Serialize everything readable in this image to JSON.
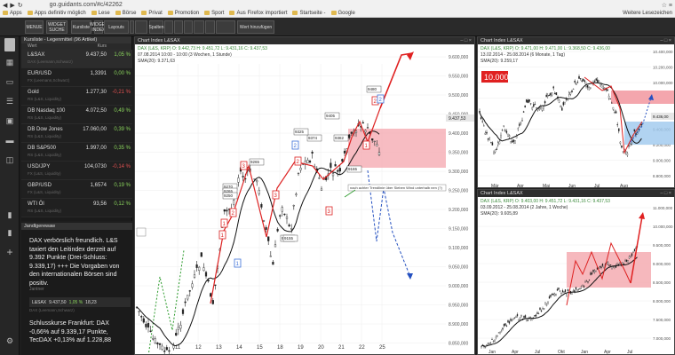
{
  "browser": {
    "url": "go.guidants.com/#c/42262",
    "bookmarks": [
      "Apps",
      "Apps definitiv möglich",
      "Lese",
      "Börse",
      "Privat",
      "Promotion",
      "Sport",
      "Aus Firefox importiert",
      "Startseite -",
      "Google"
    ],
    "right_bookmark": "Weitere Lesezeichen"
  },
  "toolbar": {
    "buttons": [
      "MENUE",
      "WIDGET SUCHE",
      "Kursliste",
      "WIDGET INDEX",
      "Layouts",
      "",
      "",
      "Spalten",
      "",
      "",
      "",
      "",
      "",
      "",
      "Wert hinzufügen"
    ]
  },
  "watchlist": {
    "title": "Kursliste - Legenmittel (96 Artikel)",
    "col_name": "Wert",
    "col_price": "Kurs",
    "rows": [
      {
        "name": "L&SAX",
        "sub": "DAX (Leemann,Schwarz)",
        "price": "9.437,50",
        "change": "1,05 %",
        "dir": "up",
        "active": true
      },
      {
        "name": "EUR/USD",
        "sub": "FX (Leemann,Schwarz)",
        "price": "1,3391",
        "change": "0,00 %",
        "dir": "up",
        "active": false
      },
      {
        "name": "Gold",
        "sub": "RS (L&S, Liquidity)",
        "price": "1.277,30",
        "change": "-0,21 %",
        "dir": "dn",
        "active": false
      },
      {
        "name": "DB Nasdaq 100",
        "sub": "RS (L&S, Liquidity)",
        "price": "4.072,50",
        "change": "0,49 %",
        "dir": "up",
        "active": false
      },
      {
        "name": "DB Dow Jones",
        "sub": "RS (L&S, Liquidity)",
        "price": "17.060,00",
        "change": "0,39 %",
        "dir": "up",
        "active": false
      },
      {
        "name": "DB S&P500",
        "sub": "RS (L&S, Liquidity)",
        "price": "1.997,00",
        "change": "0,35 %",
        "dir": "up",
        "active": false
      },
      {
        "name": "USD/JPY",
        "sub": "FX (L&S, Liquidity)",
        "price": "104,0730",
        "change": "-0,14 %",
        "dir": "dn",
        "active": false
      },
      {
        "name": "GBP/USD",
        "sub": "FX (L&S, Liquidity)",
        "price": "1,6574",
        "change": "0,19 %",
        "dir": "up",
        "active": false
      },
      {
        "name": "WTI Öl",
        "sub": "RS (L&S, Liquidity)",
        "price": "93,56",
        "change": "0,12 %",
        "dir": "up",
        "active": false
      }
    ]
  },
  "news": {
    "title": "Jandlgerewaw",
    "item1": "DAX verbörslich freundlich. L&S taxiert den Leitindex derzeit auf 9.392 Punkte (Drei-Schluss: 9.339,17) +++ Die Vorgaben von den internationalen Börsen sind positiv.",
    "item1_source": "Jantner",
    "quote_name": "L&SAX",
    "quote_price": "9.437,50",
    "quote_change": "1,05 %",
    "quote_time": "18,23",
    "quote_sub": "DAX (Leemann,Schwarz)",
    "item2": "Schlusskurse Frankfurt: DAX -0,66% auf 9.339,17 Punkte, TecDAX +0,13% auf 1.228,88"
  },
  "chart_main": {
    "header": "Chart Index L&SAX",
    "info1": "DAX (L&S, KRP)  O: 9.442,73  H: 9.451,72  L: 9.431,16  C: 9.437,53",
    "info2": "07.08.2014 10:00 - 10:00 (3 Wochen, 1 Stunde)",
    "info3": "SMA(20): 9.371,63",
    "last_price_label": "9.437,53",
    "annotation": "nach achter Trendlinie über Sieben Wind unterhalb nen (?)",
    "y_labels": [
      "9.600,000",
      "9.550,000",
      "9.500,000",
      "9.450,000",
      "9.400,000",
      "9.350,000",
      "9.300,000",
      "9.250,000",
      "9.200,000",
      "9.150,000",
      "9.100,000",
      "9.050,000",
      "9.000,000",
      "8.950,000",
      "8.900,000",
      "8.850,000"
    ],
    "x_labels": [
      "11",
      "12",
      "13",
      "14",
      "15",
      "18",
      "19",
      "20",
      "21",
      "22",
      "25"
    ],
    "price_tags": [
      "9480",
      "9405",
      "9382",
      "9374",
      "9325",
      "9270",
      "9265",
      "9265",
      "9250",
      "9185",
      "9155",
      "9165"
    ],
    "wave_labels": [
      "1",
      "2",
      "3",
      "2",
      "1",
      "3",
      "2",
      "1",
      "2",
      "3",
      "1",
      "2"
    ]
  },
  "chart_tr": {
    "header": "Chart Index L&SAX",
    "info1": "DAX (L&S, KRP)  O: 9.471,00  H: 9.471,00  L: 9.368,50  C: 9.436,00",
    "info2": "13.02.2014 - 25.08.2014 (6 Monate, 1 Tag)",
    "info3": "SMA(20): 9.259,17",
    "badge": "10.000",
    "last_label": "9.436,00",
    "y_labels": [
      "10.400,000",
      "10.200,000",
      "10.000,000",
      "9.800,000",
      "9.600,000",
      "9.400,000",
      "9.200,000",
      "9.000,000",
      "8.800,000"
    ],
    "x_labels": [
      "Mär",
      "Apr",
      "Mai",
      "Jun",
      "Jul",
      "Aug"
    ]
  },
  "chart_br": {
    "header": "Chart Index L&SAX",
    "info1": "DAX (L&S, KRP)  O: 9.403,00  H: 9.451,72  L: 9.431,16  C: 9.437,53",
    "info2": "03.09.2012 - 25.08.2014 (2 Jahre, 1 Woche)",
    "info3": "SMA(20): 9.605,89",
    "y_labels": [
      "11.000,000",
      "10.000,000",
      "9.500,000",
      "9.000,000",
      "8.500,000",
      "8.000,000",
      "7.500,000",
      "7.000,000"
    ],
    "x_labels": [
      "Jan",
      "Apr",
      "Jul",
      "Okt",
      "Jan",
      "Apr",
      "Jul"
    ]
  }
}
